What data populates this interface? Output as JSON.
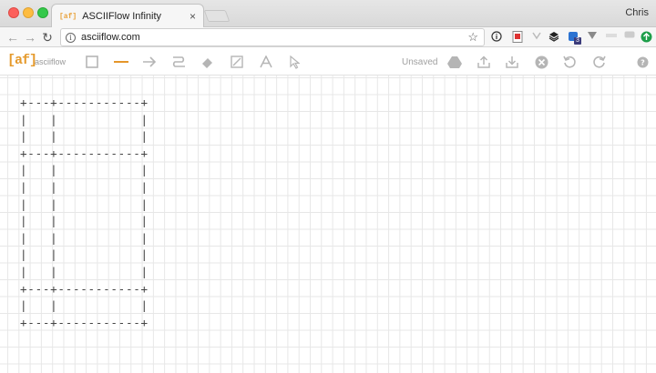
{
  "browser": {
    "tab": {
      "favicon": "[af]",
      "title": "ASCIIFlow Infinity",
      "close": "×"
    },
    "user": "Chris",
    "address": {
      "url": "asciiflow.com",
      "info": "i",
      "star": "☆"
    },
    "nav": {
      "back": "←",
      "forward": "→",
      "reload": "↻"
    },
    "extensions": [
      "info-circle-icon",
      "pdf-icon",
      "layers-icon",
      "extension-badge-icon",
      "vee-icon",
      "pin-icon",
      "chat-icon",
      "update-icon"
    ],
    "extension_badge": "3"
  },
  "app": {
    "logo": "[af]",
    "logo_name": "asciiflow",
    "status": "Unsaved",
    "tools": [
      {
        "name": "box-tool",
        "active": false
      },
      {
        "name": "line-tool",
        "active": true
      },
      {
        "name": "arrow-tool",
        "active": false
      },
      {
        "name": "freeform-tool",
        "active": false
      },
      {
        "name": "erase-tool",
        "active": false
      },
      {
        "name": "resize-tool",
        "active": false
      },
      {
        "name": "text-tool",
        "active": false
      },
      {
        "name": "select-tool",
        "active": false
      }
    ],
    "actions": [
      "drive-icon",
      "export-icon",
      "import-icon",
      "clear-icon",
      "undo-icon",
      "redo-icon",
      "help-icon"
    ],
    "accent_color": "#e5962a"
  },
  "canvas": {
    "ascii_art": "+---+-----------+\n|   |           |\n|   |           |\n+---+-----------+\n|   |           |\n|   |           |\n|   |           |\n|   |           |\n|   |           |\n|   |           |\n|   |           |\n+---+-----------+\n|   |           |\n+---+-----------+"
  }
}
